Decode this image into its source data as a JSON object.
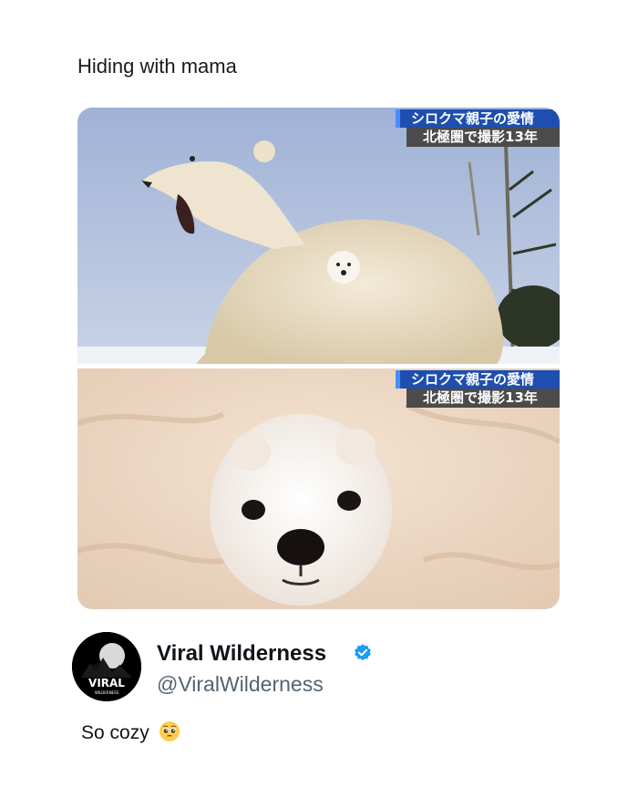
{
  "post": {
    "caption": "Hiding with mama",
    "text": "So cozy",
    "emoji": "pleading-face-emoji"
  },
  "images": {
    "top_ticker": {
      "line1": "シロクマ親子の愛情",
      "line2": "北極圏で撮影13年"
    },
    "bottom_ticker": {
      "line1": "シロクマ親子の愛情",
      "line2": "北極圏で撮影13年"
    }
  },
  "author": {
    "display_name": "Viral Wilderness",
    "handle": "@ViralWilderness",
    "avatar_text": "VIRAL",
    "avatar_subtext": "WILDERNESS",
    "verified_color": "#1d9bf0"
  }
}
